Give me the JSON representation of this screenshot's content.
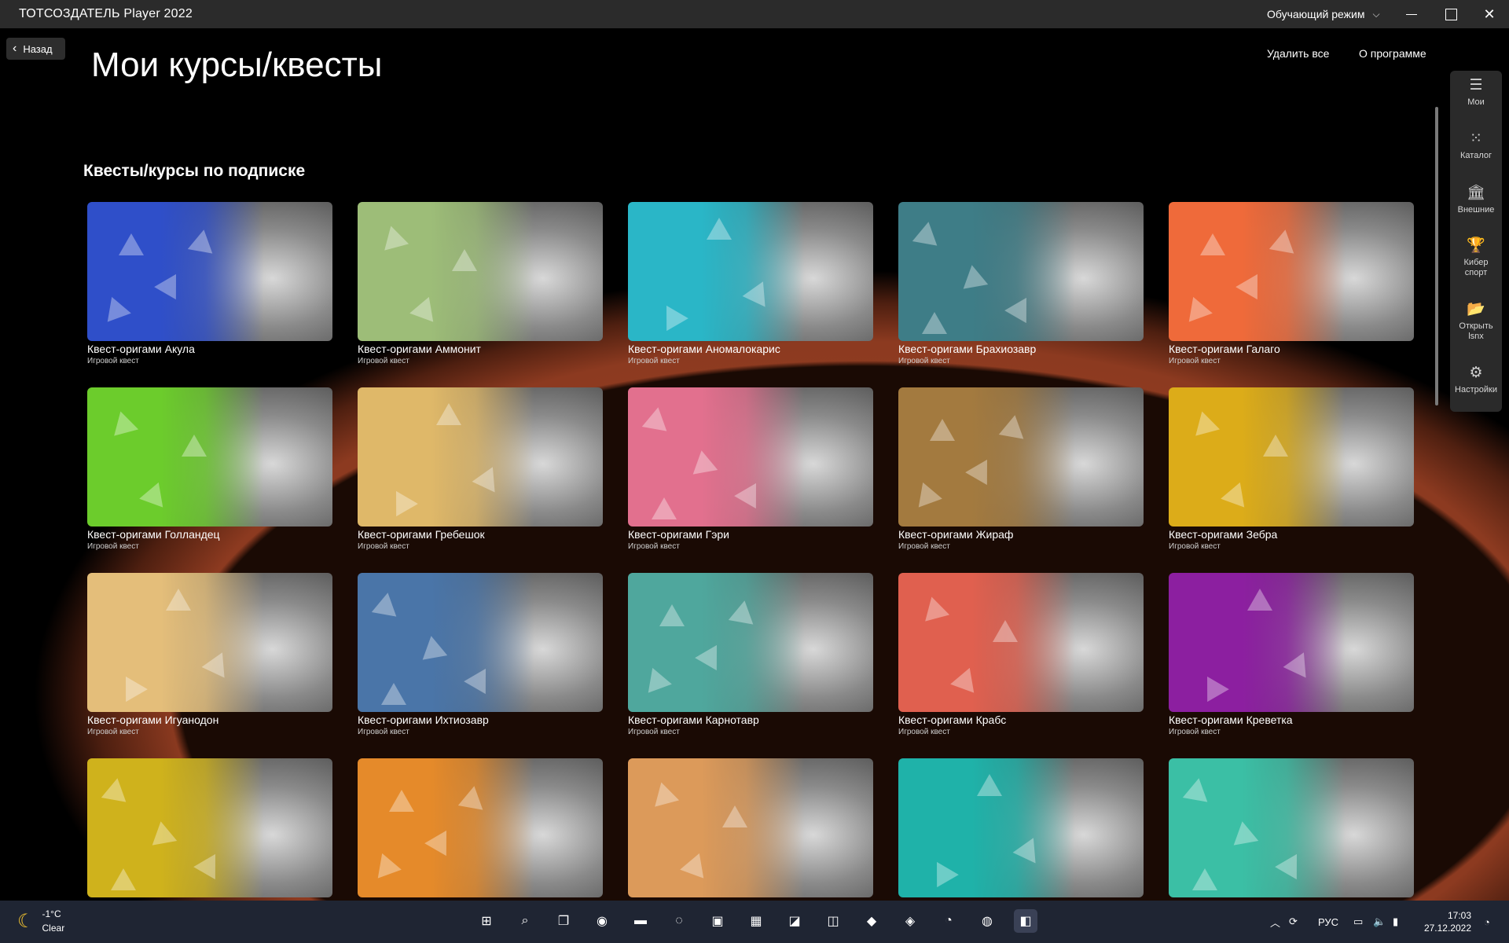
{
  "window": {
    "title": "ТОТСОЗДАТЕЛЬ Player 2022",
    "mode": "Обучающий режим",
    "min_icon": "minimize-icon",
    "max_icon": "maximize-icon",
    "close_icon": "close-icon"
  },
  "header": {
    "back_label": "Назад",
    "page_title": "Мои курсы/квесты",
    "delete_all": "Удалить все",
    "about": "О программе"
  },
  "section": {
    "title": "Квесты/курсы по подписке"
  },
  "cards": [
    {
      "name": "Квест-оригами Акула",
      "sub": "Игровой квест",
      "color": "#2f4fc9"
    },
    {
      "name": "Квест-оригами Аммонит",
      "sub": "Игровой квест",
      "color": "#9dbd78"
    },
    {
      "name": "Квест-оригами Аномалокарис",
      "sub": "Игровой квест",
      "color": "#2ab6c7"
    },
    {
      "name": "Квест-оригами Брахиозавр",
      "sub": "Игровой квест",
      "color": "#3e7d87"
    },
    {
      "name": "Квест-оригами Галаго",
      "sub": "Игровой квест",
      "color": "#ef6a3a"
    },
    {
      "name": "Квест-оригами Голландец",
      "sub": "Игровой квест",
      "color": "#6ccc2c"
    },
    {
      "name": "Квест-оригами Гребешок",
      "sub": "Игровой квест",
      "color": "#dfb869"
    },
    {
      "name": "Квест-оригами Гэри",
      "sub": "Игровой квест",
      "color": "#e2708e"
    },
    {
      "name": "Квест-оригами Жираф",
      "sub": "Игровой квест",
      "color": "#a37a3f"
    },
    {
      "name": "Квест-оригами Зебра",
      "sub": "Игровой квест",
      "color": "#dcac19"
    },
    {
      "name": "Квест-оригами Игуанодон",
      "sub": "Игровой квест",
      "color": "#e4be7a"
    },
    {
      "name": "Квест-оригами Ихтиозавр",
      "sub": "Игровой квест",
      "color": "#4a75a8"
    },
    {
      "name": "Квест-оригами Карнотавр",
      "sub": "Игровой квест",
      "color": "#4fa79d"
    },
    {
      "name": "Квест-оригами Крабс",
      "sub": "Игровой квест",
      "color": "#e0604f"
    },
    {
      "name": "Квест-оригами Креветка",
      "sub": "Игровой квест",
      "color": "#8c1fa0"
    },
    {
      "name": "",
      "sub": "",
      "color": "#cfb21c"
    },
    {
      "name": "",
      "sub": "",
      "color": "#e58a2a"
    },
    {
      "name": "",
      "sub": "",
      "color": "#dc9a5a"
    },
    {
      "name": "",
      "sub": "",
      "color": "#1fb2a9"
    },
    {
      "name": "",
      "sub": "",
      "color": "#3bbfa5"
    }
  ],
  "rail": [
    {
      "label": "Мои",
      "icon": "document-icon",
      "glyph": "☰"
    },
    {
      "label": "Каталог",
      "icon": "grid-dots-icon",
      "glyph": "⁙"
    },
    {
      "label": "Внешние",
      "icon": "bank-icon",
      "glyph": "🏛"
    },
    {
      "label": "Кибер\nспорт",
      "icon": "trophy-icon",
      "glyph": "🏆"
    },
    {
      "label": "Открыть\nlsnx",
      "icon": "folder-open-icon",
      "glyph": "📂"
    },
    {
      "label": "Настройки",
      "icon": "gear-icon",
      "glyph": "⚙"
    }
  ],
  "taskbar": {
    "temp": "-1°C",
    "condition": "Clear",
    "lang": "РУС",
    "time": "17:03",
    "date": "27.12.2022",
    "apps": [
      {
        "icon": "windows-start-icon",
        "glyph": "⊞"
      },
      {
        "icon": "search-icon",
        "glyph": "⌕"
      },
      {
        "icon": "task-view-icon",
        "glyph": "❐"
      },
      {
        "icon": "chat-icon",
        "glyph": "◉"
      },
      {
        "icon": "file-explorer-icon",
        "glyph": "▬"
      },
      {
        "icon": "edge-icon",
        "glyph": "◌"
      },
      {
        "icon": "office-icon",
        "glyph": "▣"
      },
      {
        "icon": "store-icon",
        "glyph": "▦"
      },
      {
        "icon": "app-a-icon",
        "glyph": "◪"
      },
      {
        "icon": "app-b-icon",
        "glyph": "◫"
      },
      {
        "icon": "visual-studio-icon",
        "glyph": "◆"
      },
      {
        "icon": "app-c-icon",
        "glyph": "◈"
      },
      {
        "icon": "app-d-icon",
        "glyph": "◔"
      },
      {
        "icon": "app-e-icon",
        "glyph": "◍"
      },
      {
        "icon": "totsozdatel-player-icon",
        "glyph": "◧"
      }
    ]
  }
}
